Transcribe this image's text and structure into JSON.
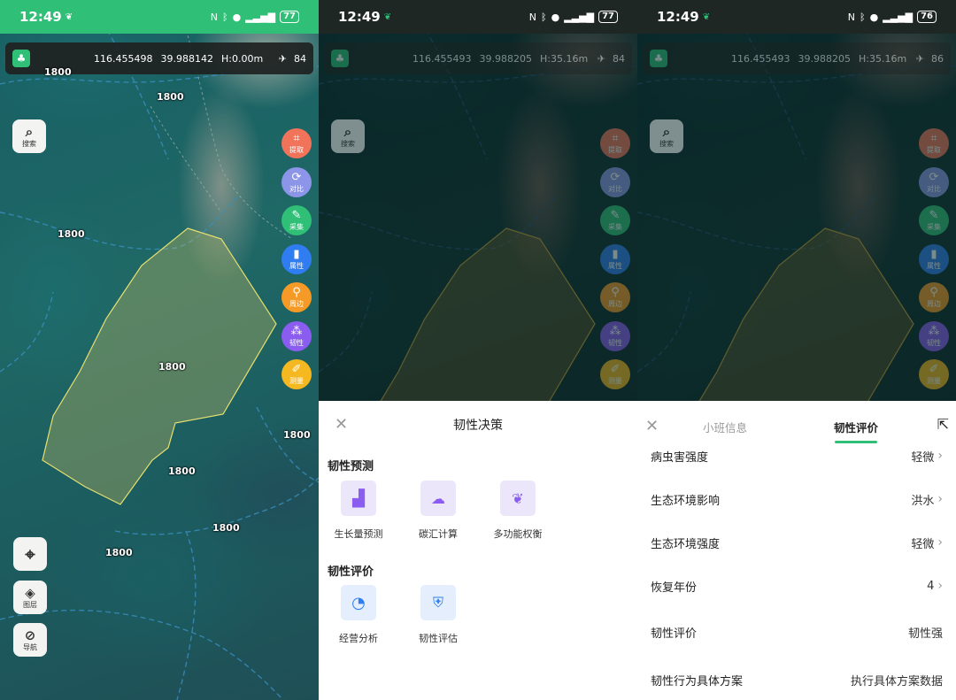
{
  "status": {
    "time": "12:49",
    "battery_1": "77",
    "battery_2": "77",
    "battery_3": "76"
  },
  "screen1": {
    "coords": {
      "lon": "116.455498",
      "lat": "39.988142",
      "h": "H:0.00m",
      "sat": "84"
    },
    "contour_labels": [
      "1800",
      "1800",
      "1800",
      "1800",
      "1800",
      "1800",
      "1800",
      "1800"
    ],
    "search_btn": "搜索",
    "right_tools": [
      "提取",
      "对比",
      "采集",
      "属性",
      "周边",
      "韧性",
      "测量"
    ],
    "layers_btn": "图层",
    "nav_btn": "导航"
  },
  "screen2": {
    "coords": {
      "lon": "116.455493",
      "lat": "39.988205",
      "h": "H:35.16m",
      "sat": "84"
    },
    "sheet_title": "韧性决策",
    "section_predict": "韧性预测",
    "predict_tools": [
      "生长量预测",
      "碳汇计算",
      "多功能权衡"
    ],
    "section_eval": "韧性评价",
    "eval_tools": [
      "经营分析",
      "韧性评估"
    ]
  },
  "screen3": {
    "coords": {
      "lon": "116.455493",
      "lat": "39.988205",
      "h": "H:35.16m",
      "sat": "86"
    },
    "tab_info": "小班信息",
    "tab_eval": "韧性评价",
    "rows": [
      {
        "label": "病虫害强度",
        "value": "轻微",
        "chevron": true
      },
      {
        "label": "生态环境影响",
        "value": "洪水",
        "chevron": true
      },
      {
        "label": "生态环境强度",
        "value": "轻微",
        "chevron": true
      },
      {
        "label": "恢复年份",
        "value": "4",
        "chevron": true
      },
      {
        "label": "韧性评价",
        "value": "韧性强",
        "chevron": false
      },
      {
        "label": "韧性行为具体方案",
        "value": "执行具体方案数据",
        "chevron": false
      }
    ]
  },
  "colors": {
    "accent": "#2fbf77",
    "extract": "#f0735a",
    "compare": "#8d95e8",
    "collect": "#2fbf77",
    "attribute": "#2f7df0",
    "nearby": "#f59a26",
    "resilience": "#8a5cf0",
    "measure": "#f5b820"
  }
}
